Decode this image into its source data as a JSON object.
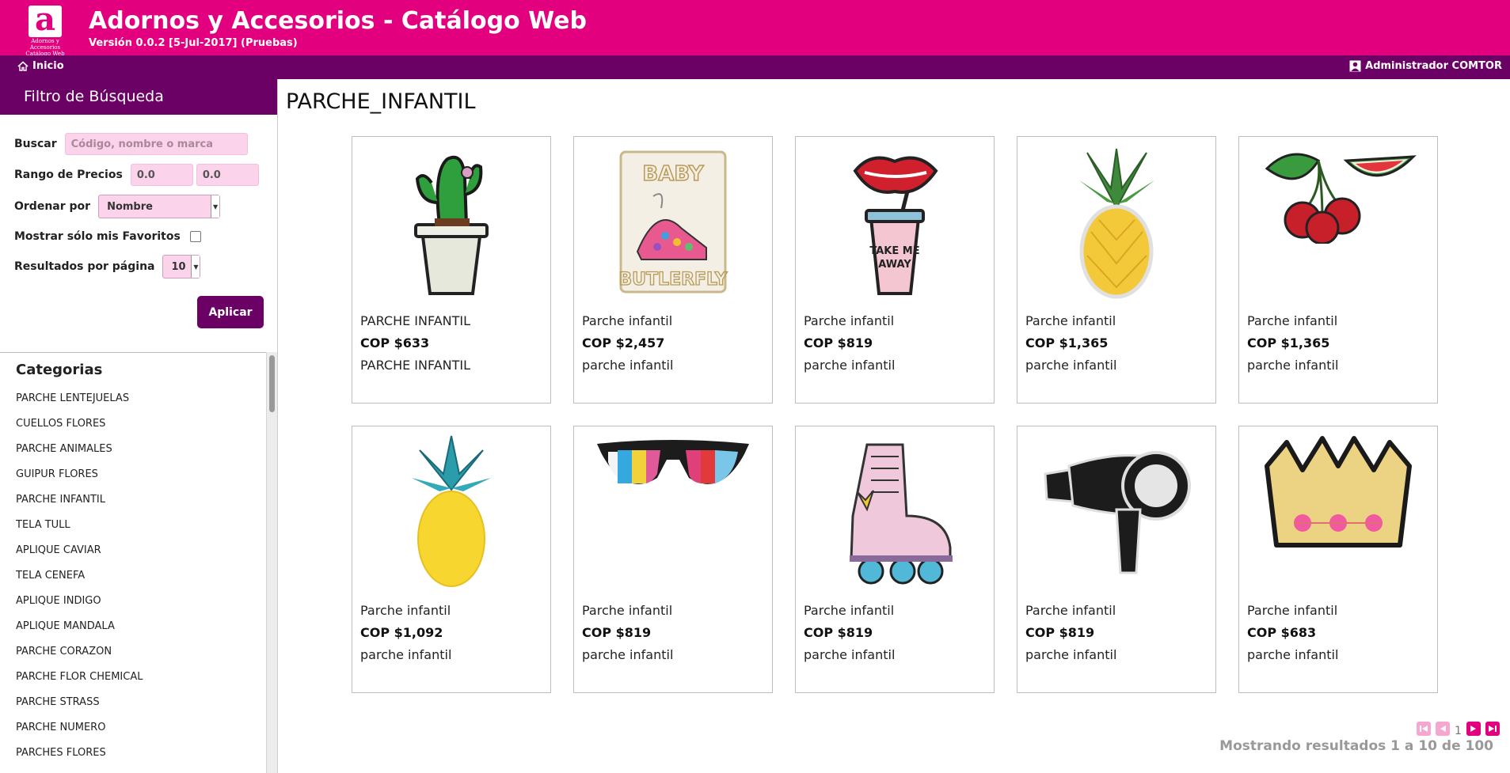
{
  "header": {
    "logo_letter": "a",
    "logo_text": "Adornos y Accesorios Catálogo Web",
    "title": "Adornos y Accesorios - Catálogo Web",
    "version": "Versión 0.0.2 [5-Jul-2017] (Pruebas)",
    "color": "#e2007e"
  },
  "nav": {
    "home_label": "Inicio",
    "home_icon": "home-icon",
    "user_label": "Administrador COMTOR",
    "user_icon": "user-icon",
    "color": "#6b0065"
  },
  "filter": {
    "title": "Filtro de Búsqueda",
    "search_label": "Buscar",
    "search_placeholder": "Código, nombre o marca",
    "price_label": "Rango de Precios",
    "price_min": "0.0",
    "price_max": "0.0",
    "order_label": "Ordenar por",
    "order_value": "Nombre",
    "favorites_label": "Mostrar sólo mis Favoritos",
    "favorites_checked": false,
    "per_page_label": "Resultados por página",
    "per_page_value": "10",
    "apply_label": "Aplicar"
  },
  "categories": {
    "title": "Categorias",
    "items": [
      "PARCHE LENTEJUELAS",
      "CUELLOS FLORES",
      "PARCHE ANIMALES",
      "GUIPUR FLORES",
      "PARCHE INFANTIL",
      "TELA TULL",
      "APLIQUE CAVIAR",
      "TELA CENEFA",
      "APLIQUE INDIGO",
      "APLIQUE MANDALA",
      "PARCHE CORAZON",
      "PARCHE FLOR CHEMICAL",
      "PARCHE STRASS",
      "PARCHE NUMERO",
      "PARCHES FLORES"
    ]
  },
  "main": {
    "title": "PARCHE_INFANTIL",
    "products": [
      {
        "name": "PARCHE INFANTIL",
        "price": "COP $633",
        "desc": "PARCHE INFANTIL",
        "image": "cactus-patch"
      },
      {
        "name": "Parche infantil",
        "price": "COP $2,457",
        "desc": "parche infantil",
        "image": "baby-butterfly-patch"
      },
      {
        "name": "Parche infantil",
        "price": "COP $819",
        "desc": "parche infantil",
        "image": "lips-cup-patch"
      },
      {
        "name": "Parche infantil",
        "price": "COP $1,365",
        "desc": "parche infantil",
        "image": "pineapple-patch"
      },
      {
        "name": "Parche infantil",
        "price": "COP $1,365",
        "desc": "parche infantil",
        "image": "cherry-watermelon-patch"
      },
      {
        "name": "Parche infantil",
        "price": "COP $1,092",
        "desc": "parche infantil",
        "image": "yellow-pineapple-patch"
      },
      {
        "name": "Parche infantil",
        "price": "COP $819",
        "desc": "parche infantil",
        "image": "sunglasses-patch"
      },
      {
        "name": "Parche infantil",
        "price": "COP $819",
        "desc": "parche infantil",
        "image": "roller-skate-patch"
      },
      {
        "name": "Parche infantil",
        "price": "COP $819",
        "desc": "parche infantil",
        "image": "hair-dryer-patch"
      },
      {
        "name": "Parche infantil",
        "price": "COP $683",
        "desc": "parche infantil",
        "image": "crown-patch"
      }
    ]
  },
  "pagination": {
    "current_page": "1",
    "results_text": "Mostrando resultados 1 a 10 de 100"
  }
}
